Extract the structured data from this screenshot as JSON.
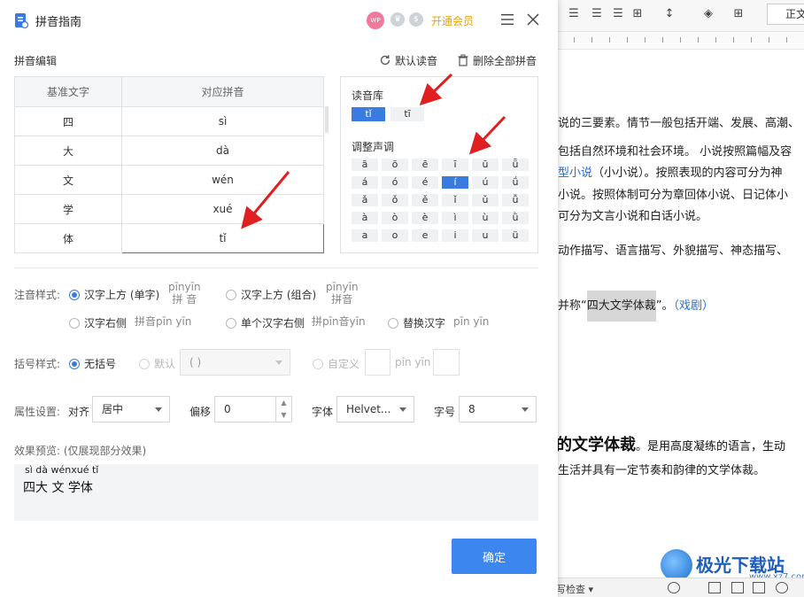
{
  "dialog": {
    "title": "拼音指南",
    "avatar_text": "WP",
    "vip_link": "开通会员"
  },
  "editor": {
    "section_title": "拼音编辑",
    "default_reading": "默认读音",
    "delete_all": "删除全部拼音",
    "table": {
      "headers": [
        "基准文字",
        "对应拼音"
      ],
      "rows": [
        {
          "char": "四",
          "pinyin": "sì"
        },
        {
          "char": "大",
          "pinyin": "dà"
        },
        {
          "char": "文",
          "pinyin": "wén"
        },
        {
          "char": "学",
          "pinyin": "xué"
        },
        {
          "char": "体",
          "pinyin": "tǐ"
        }
      ]
    }
  },
  "library": {
    "title": "读音库",
    "options": [
      "tǐ",
      "tī"
    ],
    "tone_title": "调整声调",
    "tones": [
      [
        "ā",
        "ō",
        "ē",
        "ī",
        "ū",
        "ǖ"
      ],
      [
        "á",
        "ó",
        "é",
        "í",
        "ú",
        "ǘ"
      ],
      [
        "ǎ",
        "ǒ",
        "ě",
        "ǐ",
        "ǔ",
        "ǚ"
      ],
      [
        "à",
        "ò",
        "è",
        "ì",
        "ù",
        "ǜ"
      ],
      [
        "a",
        "o",
        "e",
        "i",
        "u",
        "ü"
      ]
    ]
  },
  "annotation": {
    "label": "注音样式:",
    "opt_above_single": "汉字上方 (单字)",
    "sample_above_single_top": "pīnyīn",
    "sample_above_single_bottom": "拼  音",
    "opt_above_group": "汉字上方 (组合)",
    "sample_above_group_top": "pīnyīn",
    "sample_above_group_bottom": "拼音",
    "opt_right": "汉字右侧",
    "sample_right": "拼音pīn yīn",
    "opt_single_right": "单个汉字右侧",
    "sample_single_right": "拼pīn音yīn",
    "opt_replace": "替换汉字",
    "sample_replace": "pīn yīn"
  },
  "bracket": {
    "label": "括号样式:",
    "opt_none": "无括号",
    "opt_default": "默认",
    "default_value": "( )",
    "opt_custom": "自定义",
    "sample": "pīn yīn"
  },
  "properties": {
    "label": "属性设置:",
    "align_label": "对齐",
    "align_value": "居中",
    "offset_label": "偏移",
    "offset_value": "0",
    "font_label": "字体",
    "font_value": "Helvet...",
    "size_label": "字号",
    "size_value": "8"
  },
  "preview": {
    "label": "效果预览:    (仅展现部分效果)",
    "pinyin_line": "sì dà wénxué tǐ",
    "hanzi_line": "四大 文 学体"
  },
  "ok_button": "确定",
  "document": {
    "toolbar_style": "正文",
    "lines": [
      "说的三要素。情节一般包括开端、发展、高潮、",
      "包括自然环境和社会环境。 小说按照篇幅及容",
      "小说。按照体制可分为章回体小说、日记体小",
      "可分为文言小说和白话小说。",
      "动作描写、语言描写、外貌描写、神态描写、",
      "生活并具有一定节奏和韵律的文学体裁。"
    ],
    "link_line_link": "型小说",
    "link_line_rest": "（小小说）。按照表现的内容可分为神",
    "highlight_prefix": "并称“",
    "highlight_text": "四大文学体裁",
    "highlight_suffix": "”。",
    "highlight_link": "（戏剧）",
    "heading_bold": "的文学体裁",
    "heading_rest": "。是用高度凝练的语言，生动",
    "status_text": "写检查 ▾",
    "watermark_text": "极光下载站",
    "watermark_url": "www.xz7.com"
  }
}
